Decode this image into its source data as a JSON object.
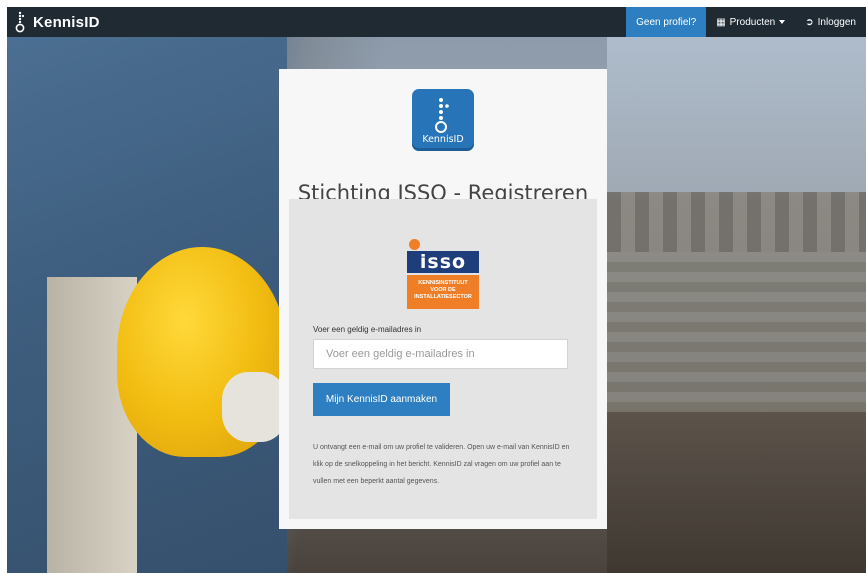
{
  "navbar": {
    "brand": "KennisID",
    "items": [
      {
        "label": "Geen profiel?",
        "icon": ""
      },
      {
        "label": "Producten",
        "icon": "grid-icon"
      },
      {
        "label": "Inloggen",
        "icon": "login-icon"
      }
    ],
    "accent": "#2d7fc1",
    "bg": "#1f2a33"
  },
  "card": {
    "logo_text": "KennisID",
    "title": "Stichting ISSO - Registreren",
    "org_logo": {
      "word": "isso",
      "tagline": [
        "KENNISINSTITUUT",
        "VOOR DE",
        "INSTALLATIESECTOR"
      ]
    },
    "email_label": "Voer een geldig e-mailadres in",
    "email_placeholder": "Voer een geldig e-mailadres in",
    "submit_label": "Mijn KennisID aanmaken",
    "note": "U ontvangt een e-mail om uw profiel te valideren. Open uw e-mail van KennisID en klik op de snelkoppeling in het bericht. KennisID zal vragen om uw profiel aan te vullen met een beperkt aantal gegevens."
  }
}
